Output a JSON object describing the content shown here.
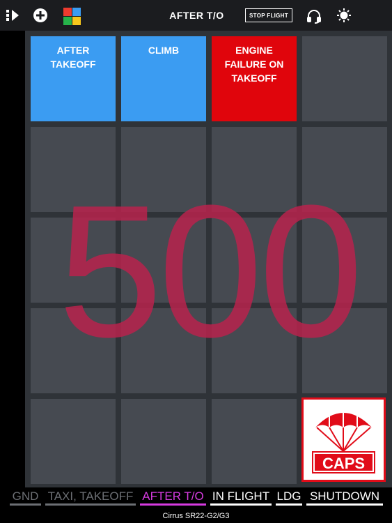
{
  "header": {
    "title": "AFTER T/O",
    "stop_flight_label": "STOP FLIGHT"
  },
  "tiles": [
    {
      "label": "AFTER TAKEOFF",
      "color": "#3b9cf2"
    },
    {
      "label": "CLIMB",
      "color": "#3b9cf2"
    },
    {
      "label": "ENGINE FAILURE ON TAKEOFF",
      "color": "#e0050c"
    }
  ],
  "altitude_overlay": "500",
  "caps": {
    "label": "CAPS"
  },
  "phases": [
    {
      "label": "GND",
      "state": "past"
    },
    {
      "label": "TAXI, TAKEOFF",
      "state": "past"
    },
    {
      "label": "AFTER T/O",
      "state": "active"
    },
    {
      "label": "IN FLIGHT",
      "state": "future"
    },
    {
      "label": "LDG",
      "state": "future"
    },
    {
      "label": "SHUTDOWN",
      "state": "future"
    }
  ],
  "aircraft": "Cirrus SR22-G2/G3",
  "colors": {
    "tile_blue": "#3b9cf2",
    "tile_red": "#e0050c",
    "overlay": "#b8234d",
    "active_phase": "#d63be0",
    "caps_red": "#e10c19"
  }
}
